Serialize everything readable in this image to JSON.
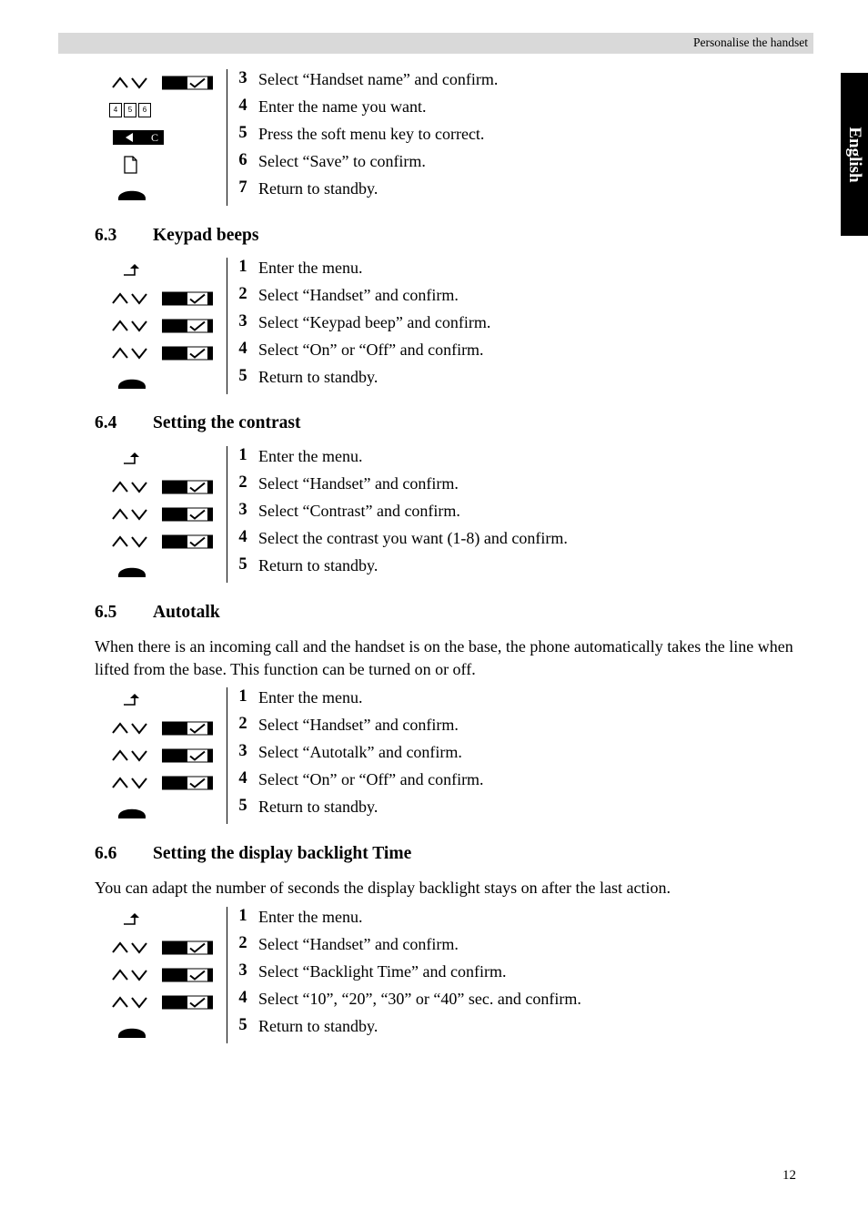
{
  "header": {
    "running_title": "Personalise the handset"
  },
  "language_tab": {
    "label": "English"
  },
  "page_number": "12",
  "sections": [
    {
      "id": "handset-name-continued",
      "number": "",
      "title": "",
      "intro": "",
      "steps": [
        {
          "num": "3",
          "text": "Select “Handset name” and confirm.",
          "icons": [
            "updown",
            "softkey"
          ]
        },
        {
          "num": "4",
          "text": "Enter the name you want.",
          "icons": [
            "digits"
          ]
        },
        {
          "num": "5",
          "text": "Press the soft menu key to correct.",
          "icons": [
            "clear"
          ]
        },
        {
          "num": "6",
          "text": "Select “Save” to confirm.",
          "icons": [
            "save"
          ]
        },
        {
          "num": "7",
          "text": "Return to standby.",
          "icons": [
            "hook"
          ]
        }
      ]
    },
    {
      "id": "keypad-beeps",
      "number": "6.3",
      "title": "Keypad beeps",
      "intro": "",
      "steps": [
        {
          "num": "1",
          "text": "Enter the menu.",
          "icons": [
            "menu"
          ]
        },
        {
          "num": "2",
          "text": "Select “Handset” and confirm.",
          "icons": [
            "updown",
            "softkey"
          ]
        },
        {
          "num": "3",
          "text": "Select “Keypad beep” and confirm.",
          "icons": [
            "updown",
            "softkey"
          ]
        },
        {
          "num": "4",
          "text": "Select “On” or “Off” and confirm.",
          "icons": [
            "updown",
            "softkey"
          ]
        },
        {
          "num": "5",
          "text": "Return to standby.",
          "icons": [
            "hook"
          ]
        }
      ]
    },
    {
      "id": "setting-the-contrast",
      "number": "6.4",
      "title": "Setting the contrast",
      "intro": "",
      "steps": [
        {
          "num": "1",
          "text": "Enter the menu.",
          "icons": [
            "menu"
          ]
        },
        {
          "num": "2",
          "text": "Select “Handset” and confirm.",
          "icons": [
            "updown",
            "softkey"
          ]
        },
        {
          "num": "3",
          "text": "Select “Contrast” and confirm.",
          "icons": [
            "updown",
            "softkey"
          ]
        },
        {
          "num": "4",
          "text": "Select the contrast you want (1-8) and confirm.",
          "icons": [
            "updown",
            "softkey"
          ]
        },
        {
          "num": "5",
          "text": "Return to standby.",
          "icons": [
            "hook"
          ]
        }
      ]
    },
    {
      "id": "autotalk",
      "number": "6.5",
      "title": "Autotalk",
      "intro": "When there is an incoming call and the handset is on the base, the phone automatically takes the line when lifted from the base. This function can be turned on or off.",
      "steps": [
        {
          "num": "1",
          "text": "Enter the menu.",
          "icons": [
            "menu"
          ]
        },
        {
          "num": "2",
          "text": "Select “Handset” and confirm.",
          "icons": [
            "updown",
            "softkey"
          ]
        },
        {
          "num": "3",
          "text": "Select “Autotalk” and confirm.",
          "icons": [
            "updown",
            "softkey"
          ]
        },
        {
          "num": "4",
          "text": "Select “On” or “Off” and confirm.",
          "icons": [
            "updown",
            "softkey"
          ]
        },
        {
          "num": "5",
          "text": "Return to standby.",
          "icons": [
            "hook"
          ]
        }
      ]
    },
    {
      "id": "setting-the-display-backlight-time",
      "number": "6.6",
      "title": "Setting the display backlight Time",
      "intro": "You can adapt the number of seconds the display backlight stays on after the last action.",
      "steps": [
        {
          "num": "1",
          "text": "Enter the menu.",
          "icons": [
            "menu"
          ]
        },
        {
          "num": "2",
          "text": "Select “Handset” and confirm.",
          "icons": [
            "updown",
            "softkey"
          ]
        },
        {
          "num": "3",
          "text": "Select “Backlight Time” and confirm.",
          "icons": [
            "updown",
            "softkey"
          ]
        },
        {
          "num": "4",
          "text": "Select “10”, “20”, “30” or “40” sec. and confirm.",
          "icons": [
            "updown",
            "softkey"
          ]
        },
        {
          "num": "5",
          "text": "Return to standby.",
          "icons": [
            "hook"
          ]
        }
      ]
    }
  ],
  "icon_names": {
    "updown": "up-down-arrows-icon",
    "softkey": "soft-key-confirm-icon",
    "menu": "enter-menu-icon",
    "hook": "handset-hook-icon",
    "digits": "keypad-digits-icon",
    "clear": "clear-key-icon",
    "save": "save-page-icon"
  },
  "digits_icon_labels": [
    "4",
    "5",
    "6"
  ],
  "clear_icon_label": "C"
}
